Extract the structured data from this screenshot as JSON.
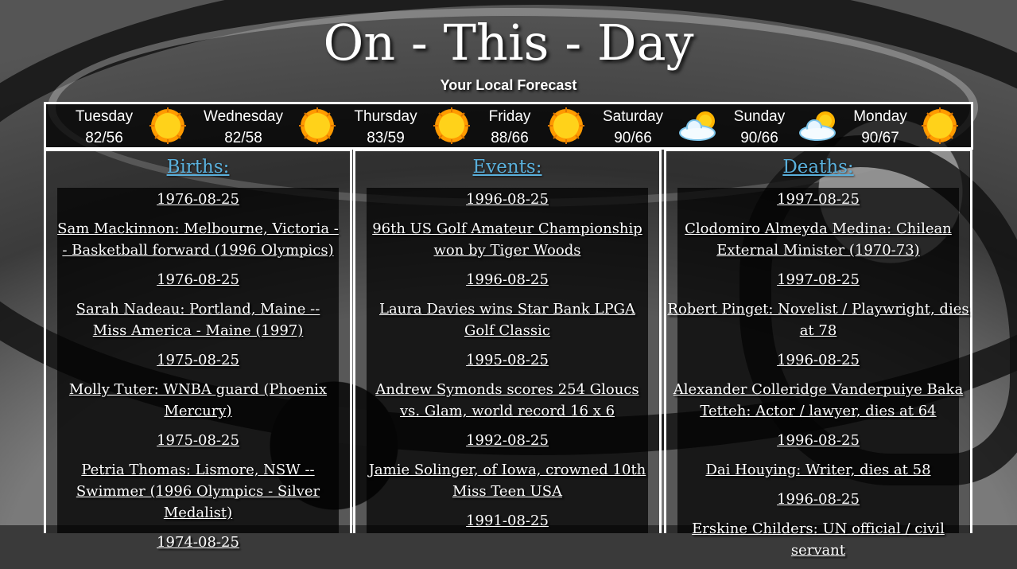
{
  "title": "On - This - Day",
  "subtitle": "Your Local Forecast",
  "forecast": [
    {
      "day": "Tuesday",
      "temps": "82/56",
      "icon": "sun-icon"
    },
    {
      "day": "Wednesday",
      "temps": "82/58",
      "icon": "sun-icon"
    },
    {
      "day": "Thursday",
      "temps": "83/59",
      "icon": "sun-icon"
    },
    {
      "day": "Friday",
      "temps": "88/66",
      "icon": "sun-icon"
    },
    {
      "day": "Saturday",
      "temps": "90/66",
      "icon": "partly-cloudy-icon"
    },
    {
      "day": "Sunday",
      "temps": "90/66",
      "icon": "partly-cloudy-icon"
    },
    {
      "day": "Monday",
      "temps": "90/67",
      "icon": "sun-icon"
    }
  ],
  "births": {
    "heading": "Births:",
    "items": [
      {
        "date": "1976-08-25",
        "text": "Sam Mackinnon: Melbourne, Victoria -- Basketball forward (1996 Olympics)"
      },
      {
        "date": "1976-08-25",
        "text": "Sarah Nadeau: Portland, Maine -- Miss America - Maine (1997)"
      },
      {
        "date": "1975-08-25",
        "text": "Molly Tuter: WNBA guard (Phoenix Mercury)"
      },
      {
        "date": "1975-08-25",
        "text": "Petria Thomas: Lismore, NSW -- Swimmer (1996 Olympics - Silver Medalist)"
      },
      {
        "date": "1974-08-25",
        "text": ""
      }
    ]
  },
  "events": {
    "heading": "Events:",
    "items": [
      {
        "date": "1996-08-25",
        "text": "96th US Golf Amateur Championship won by Tiger Woods"
      },
      {
        "date": "1996-08-25",
        "text": "Laura Davies wins Star Bank LPGA Golf Classic"
      },
      {
        "date": "1995-08-25",
        "text": "Andrew Symonds scores 254 Gloucs vs. Glam, world record 16 x 6"
      },
      {
        "date": "1992-08-25",
        "text": "Jamie Solinger, of Iowa, crowned 10th Miss Teen USA"
      },
      {
        "date": "1991-08-25",
        "text": ""
      }
    ]
  },
  "deaths": {
    "heading": "Deaths:",
    "items": [
      {
        "date": "1997-08-25",
        "text": "Clodomiro Almeyda Medina: Chilean External Minister (1970-73)"
      },
      {
        "date": "1997-08-25",
        "text": "Robert Pinget: Novelist / Playwright, dies at 78"
      },
      {
        "date": "1996-08-25",
        "text": "Alexander Colleridge Vanderpuiye Baka Tetteh: Actor / lawyer, dies at 64"
      },
      {
        "date": "1996-08-25",
        "text": "Dai Houying: Writer, dies at 58"
      },
      {
        "date": "1996-08-25",
        "text": "Erskine Childers: UN official / civil servant"
      }
    ]
  },
  "colors": {
    "heading_link": "#5ab0dc",
    "border": "#ffffff",
    "sun": "#ffb400"
  }
}
